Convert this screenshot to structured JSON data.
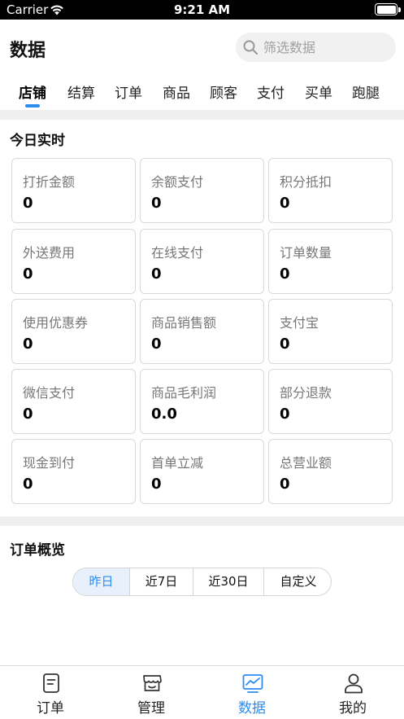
{
  "status_bar": {
    "carrier": "Carrier",
    "time": "9:21 AM"
  },
  "header": {
    "title": "数据",
    "search_placeholder": "筛选数据"
  },
  "tabs": [
    {
      "label": "店铺",
      "active": true
    },
    {
      "label": "结算",
      "active": false
    },
    {
      "label": "订单",
      "active": false
    },
    {
      "label": "商品",
      "active": false
    },
    {
      "label": "顾客",
      "active": false
    },
    {
      "label": "支付",
      "active": false
    },
    {
      "label": "买单",
      "active": false
    },
    {
      "label": "跑腿",
      "active": false
    }
  ],
  "realtime": {
    "title": "今日实时",
    "cards": [
      {
        "label": "打折金额",
        "value": "0"
      },
      {
        "label": "余额支付",
        "value": "0"
      },
      {
        "label": "积分抵扣",
        "value": "0"
      },
      {
        "label": "外送费用",
        "value": "0"
      },
      {
        "label": "在线支付",
        "value": "0"
      },
      {
        "label": "订单数量",
        "value": "0"
      },
      {
        "label": "使用优惠券",
        "value": "0"
      },
      {
        "label": "商品销售额",
        "value": "0"
      },
      {
        "label": "支付宝",
        "value": "0"
      },
      {
        "label": "微信支付",
        "value": "0"
      },
      {
        "label": "商品毛利润",
        "value": "0.0"
      },
      {
        "label": "部分退款",
        "value": "0"
      },
      {
        "label": "现金到付",
        "value": "0"
      },
      {
        "label": "首单立减",
        "value": "0"
      },
      {
        "label": "总营业额",
        "value": "0"
      }
    ]
  },
  "overview": {
    "title": "订单概览",
    "ranges": [
      {
        "label": "昨日",
        "active": true
      },
      {
        "label": "近7日",
        "active": false
      },
      {
        "label": "近30日",
        "active": false
      },
      {
        "label": "自定义",
        "active": false
      }
    ]
  },
  "tabbar": [
    {
      "label": "订单",
      "icon": "order-icon",
      "active": false
    },
    {
      "label": "管理",
      "icon": "store-icon",
      "active": false
    },
    {
      "label": "数据",
      "icon": "chart-icon",
      "active": true
    },
    {
      "label": "我的",
      "icon": "user-icon",
      "active": false
    }
  ],
  "colors": {
    "accent": "#2d8cf0",
    "muted_text": "#777777",
    "separator": "#efefef"
  }
}
